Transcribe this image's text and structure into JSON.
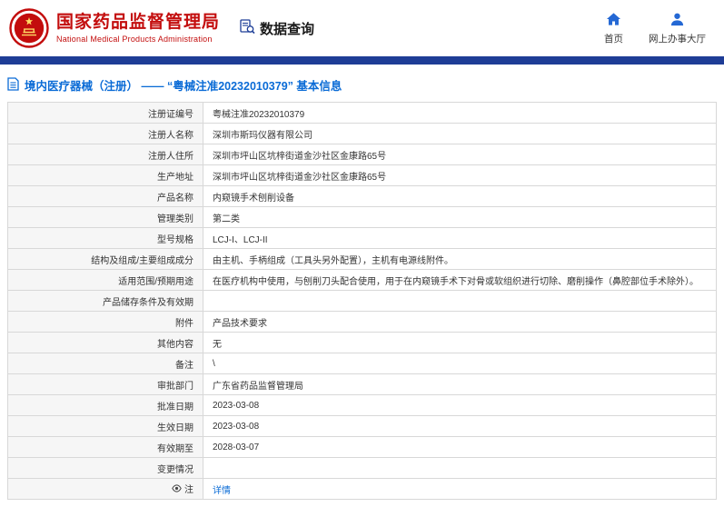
{
  "header": {
    "org_name_cn": "国家药品监督管理局",
    "org_name_en": "National Medical Products Administration",
    "section_title": "数据查询",
    "nav": [
      {
        "label": "首页"
      },
      {
        "label": "网上办事大厅"
      }
    ]
  },
  "colors": {
    "brand_red": "#c30d0d",
    "bar_blue": "#1e3d96",
    "nav_icon_blue": "#2468d4",
    "link_blue": "#0a6bd6"
  },
  "breadcrumb": {
    "text": "境内医疗器械（注册） —— “粤械注准20232010379” 基本信息"
  },
  "table": {
    "rows": [
      {
        "label": "注册证编号",
        "value": "粤械注准20232010379"
      },
      {
        "label": "注册人名称",
        "value": "深圳市斯玛仪器有限公司"
      },
      {
        "label": "注册人住所",
        "value": "深圳市坪山区坑梓街道金沙社区金康路65号"
      },
      {
        "label": "生产地址",
        "value": "深圳市坪山区坑梓街道金沙社区金康路65号"
      },
      {
        "label": "产品名称",
        "value": "内窥镜手术刨削设备"
      },
      {
        "label": "管理类别",
        "value": "第二类"
      },
      {
        "label": "型号规格",
        "value": "LCJ-I、LCJ-II"
      },
      {
        "label": "结构及组成/主要组成成分",
        "value": "由主机、手柄组成（工具头另外配置），主机有电源线附件。"
      },
      {
        "label": "适用范围/预期用途",
        "value": "在医疗机构中使用，与刨削刀头配合使用，用于在内窥镜手术下对骨或软组织进行切除、磨削操作（鼻腔部位手术除外）。"
      },
      {
        "label": "产品储存条件及有效期",
        "value": ""
      },
      {
        "label": "附件",
        "value": "产品技术要求"
      },
      {
        "label": "其他内容",
        "value": "无"
      },
      {
        "label": "备注",
        "value": "\\"
      },
      {
        "label": "审批部门",
        "value": "广东省药品监督管理局"
      },
      {
        "label": "批准日期",
        "value": "2023-03-08"
      },
      {
        "label": "生效日期",
        "value": "2023-03-08"
      },
      {
        "label": "有效期至",
        "value": "2028-03-07"
      },
      {
        "label": "变更情况",
        "value": ""
      },
      {
        "label": "注",
        "value": "详情",
        "label_icon": "note-icon",
        "link": true
      }
    ]
  }
}
